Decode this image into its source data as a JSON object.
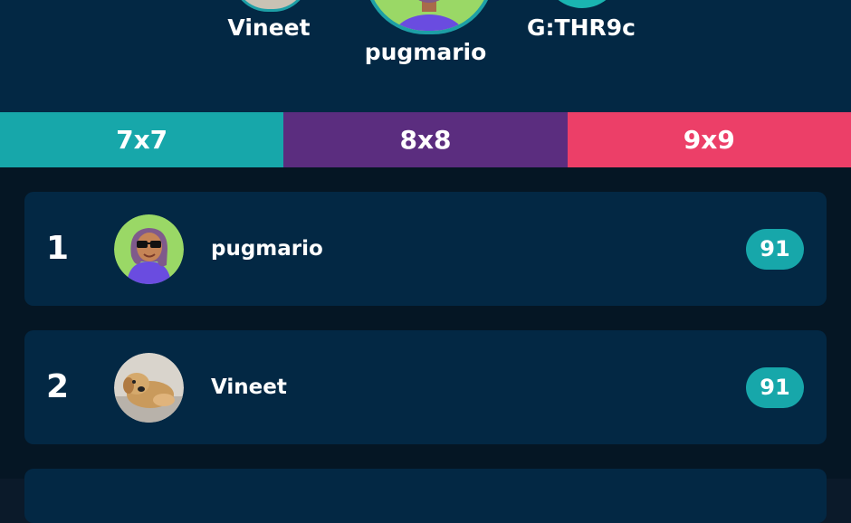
{
  "podium": {
    "second": {
      "name": "Vineet"
    },
    "first": {
      "name": "pugmario"
    },
    "third": {
      "name": "G:THR9c"
    }
  },
  "tabs": [
    {
      "label": "7x7",
      "color": "#17a7aa"
    },
    {
      "label": "8x8",
      "color": "#5b2d7f"
    },
    {
      "label": "9x9",
      "color": "#ec3f68"
    }
  ],
  "leaderboard": [
    {
      "rank": "1",
      "name": "pugmario",
      "score": "91",
      "avatar": "sunglasses-avatar-icon"
    },
    {
      "rank": "2",
      "name": "Vineet",
      "score": "91",
      "avatar": "dog-photo-avatar"
    }
  ],
  "colors": {
    "background": "#0b1a2a",
    "panel": "#032844",
    "accent": "#17a7aa"
  }
}
